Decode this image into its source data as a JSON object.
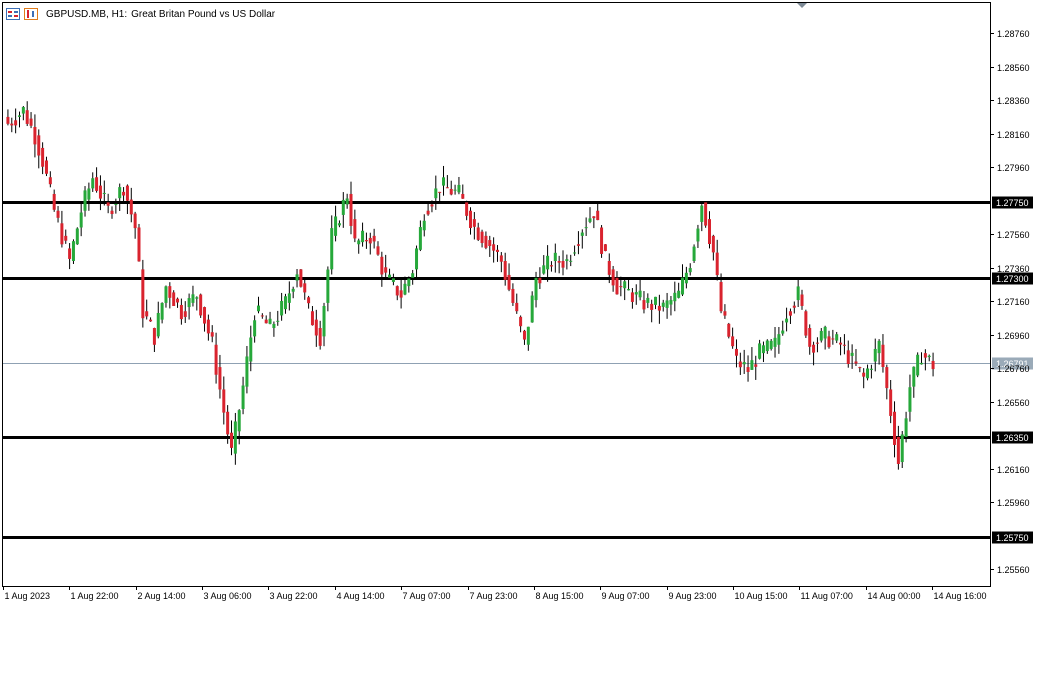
{
  "header": {
    "symbol": "GBPUSD.MB, H1:",
    "description": "Great Britan Pound vs US Dollar"
  },
  "colors": {
    "bull": "#26a83a",
    "bear": "#d9232e",
    "wick": "#000000",
    "level": "#000000",
    "current": "#8fa1b3",
    "axis": "#000000",
    "tag_bg": "#000000",
    "tag_text": "#ffffff",
    "current_tag_bg": "#9aaab8"
  },
  "chart_data": {
    "type": "candlestick",
    "timeframe": "H1",
    "ylim": [
      1.2546,
      1.2894
    ],
    "y_ticks": [
      "1.28760",
      "1.28560",
      "1.28360",
      "1.28160",
      "1.27960",
      "1.27560",
      "1.27360",
      "1.27160",
      "1.26960",
      "1.26760",
      "1.26560",
      "1.26160",
      "1.25960",
      "1.25560"
    ],
    "x_ticks": [
      "1 Aug 2023",
      "1 Aug 22:00",
      "2 Aug 14:00",
      "3 Aug 06:00",
      "3 Aug 22:00",
      "4 Aug 14:00",
      "7 Aug 07:00",
      "7 Aug 23:00",
      "8 Aug 15:00",
      "9 Aug 07:00",
      "9 Aug 23:00",
      "10 Aug 15:00",
      "11 Aug 07:00",
      "14 Aug 00:00",
      "14 Aug 16:00"
    ],
    "levels": [
      {
        "value": 1.2775,
        "label": "1.27750"
      },
      {
        "value": 1.273,
        "label": "1.27300"
      },
      {
        "value": 1.2635,
        "label": "1.26350"
      },
      {
        "value": 1.2575,
        "label": "1.25750"
      }
    ],
    "current_price": {
      "value": 1.26791,
      "label": "1.26791"
    },
    "close_waypoints": [
      [
        0,
        1.2822
      ],
      [
        4,
        1.283
      ],
      [
        7,
        1.2815
      ],
      [
        9,
        1.28
      ],
      [
        12,
        1.277
      ],
      [
        16,
        1.274
      ],
      [
        19,
        1.277
      ],
      [
        22,
        1.279
      ],
      [
        26,
        1.277
      ],
      [
        30,
        1.2785
      ],
      [
        33,
        1.276
      ],
      [
        35,
        1.271
      ],
      [
        38,
        1.2695
      ],
      [
        41,
        1.2725
      ],
      [
        45,
        1.271
      ],
      [
        49,
        1.272
      ],
      [
        53,
        1.269
      ],
      [
        56,
        1.265
      ],
      [
        58,
        1.2625
      ],
      [
        61,
        1.2665
      ],
      [
        64,
        1.271
      ],
      [
        68,
        1.27
      ],
      [
        72,
        1.2715
      ],
      [
        75,
        1.2735
      ],
      [
        78,
        1.271
      ],
      [
        81,
        1.2695
      ],
      [
        84,
        1.2755
      ],
      [
        88,
        1.278
      ],
      [
        90,
        1.275
      ],
      [
        94,
        1.2755
      ],
      [
        98,
        1.273
      ],
      [
        102,
        1.272
      ],
      [
        105,
        1.2735
      ],
      [
        108,
        1.277
      ],
      [
        112,
        1.2785
      ],
      [
        117,
        1.278
      ],
      [
        121,
        1.276
      ],
      [
        125,
        1.275
      ],
      [
        128,
        1.274
      ],
      [
        131,
        1.2715
      ],
      [
        134,
        1.269
      ],
      [
        137,
        1.273
      ],
      [
        141,
        1.274
      ],
      [
        145,
        1.274
      ],
      [
        149,
        1.276
      ],
      [
        152,
        1.277
      ],
      [
        155,
        1.274
      ],
      [
        158,
        1.2725
      ],
      [
        162,
        1.272
      ],
      [
        165,
        1.2715
      ],
      [
        170,
        1.2712
      ],
      [
        174,
        1.272
      ],
      [
        177,
        1.274
      ],
      [
        180,
        1.2775
      ],
      [
        183,
        1.2745
      ],
      [
        185,
        1.271
      ],
      [
        189,
        1.268
      ],
      [
        192,
        1.2675
      ],
      [
        195,
        1.2685
      ],
      [
        199,
        1.269
      ],
      [
        202,
        1.271
      ],
      [
        205,
        1.272
      ],
      [
        208,
        1.269
      ],
      [
        212,
        1.2695
      ],
      [
        216,
        1.269
      ],
      [
        219,
        1.268
      ],
      [
        222,
        1.267
      ],
      [
        226,
        1.269
      ],
      [
        229,
        1.265
      ],
      [
        231,
        1.262
      ],
      [
        234,
        1.2665
      ],
      [
        237,
        1.2685
      ],
      [
        240,
        1.2678
      ]
    ]
  }
}
